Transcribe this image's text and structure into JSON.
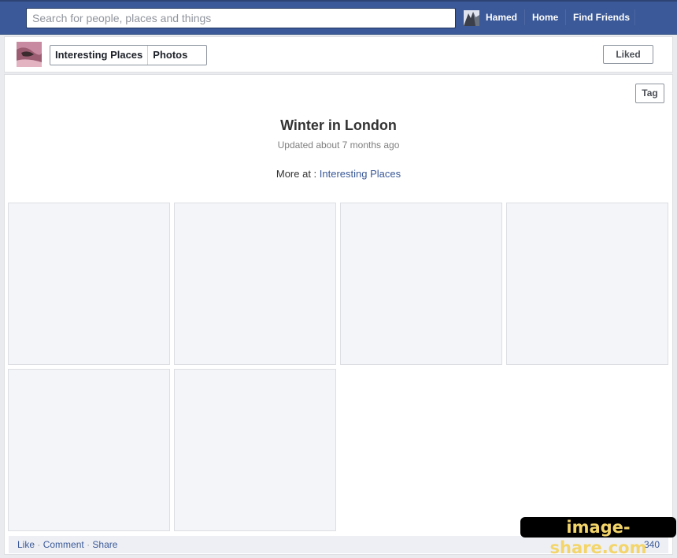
{
  "topbar": {
    "search_placeholder": "Search for people, places and things",
    "user_name": "Hamed",
    "home_label": "Home",
    "find_friends_label": "Find Friends"
  },
  "page_header": {
    "tabs": [
      {
        "label": "Interesting Places"
      },
      {
        "label": "Photos"
      }
    ],
    "liked_label": "Liked"
  },
  "album": {
    "tag_label": "Tag",
    "title": "Winter in London",
    "updated": "Updated about 7 months ago",
    "more_at_prefix": "More at :",
    "more_at_link": "Interesting Places",
    "photo_count_shown": 6
  },
  "footer": {
    "like": "Like",
    "comment": "Comment",
    "share": "Share",
    "separator": "·",
    "count": "340"
  },
  "watermark": {
    "text": "image-share.com"
  },
  "colors": {
    "brand_blue": "#3b5998",
    "link_blue": "#3b5998",
    "photo_placeholder": "#f4f5f8"
  }
}
